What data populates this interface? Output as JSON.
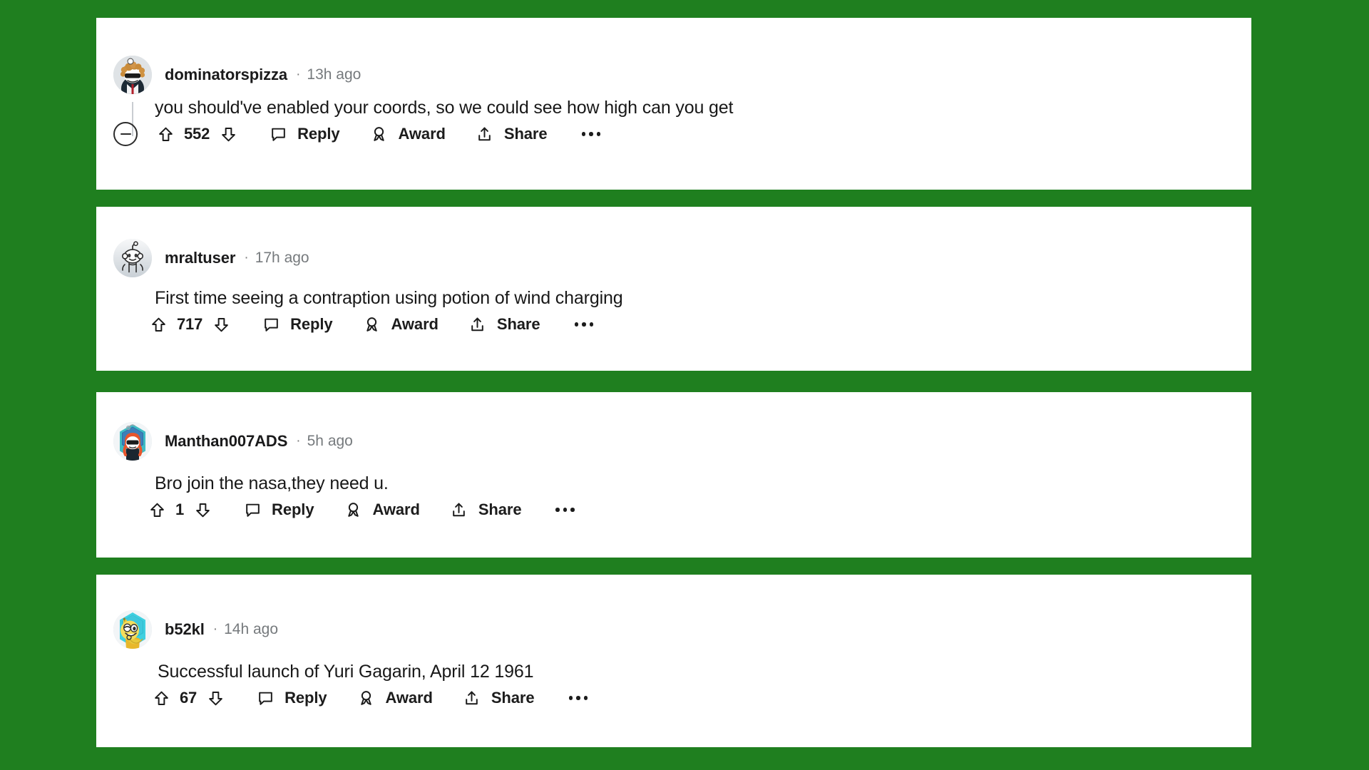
{
  "page": {
    "background_color": "#1f7f1f",
    "card_background": "#ffffff",
    "text_color": "#181818",
    "meta_color": "#767a7d"
  },
  "labels": {
    "reply": "Reply",
    "award": "Award",
    "share": "Share",
    "separator": "·"
  },
  "icons": {
    "collapse": "minus-circle-icon",
    "upvote": "upvote-arrow-icon",
    "downvote": "downvote-arrow-icon",
    "reply": "comment-bubble-icon",
    "award": "award-ribbon-icon",
    "share": "share-upload-icon",
    "overflow": "more-options-icon"
  },
  "comments": [
    {
      "username": "dominatorspizza",
      "timestamp": "13h ago",
      "text": "you should've enabled your coords, so we could see how high can you get",
      "score": "552",
      "has_collapse_button": true,
      "has_thread_line": true,
      "avatar": "avatar-curly-hair-sunglasses-suit"
    },
    {
      "username": "mraltuser",
      "timestamp": "17h ago",
      "text": "First time seeing a contraption using potion of wind charging",
      "score": "717",
      "has_collapse_button": false,
      "has_thread_line": false,
      "avatar": "avatar-default-snoo"
    },
    {
      "username": "Manthan007ADS",
      "timestamp": "5h ago",
      "text": "Bro join the nasa,they need u.",
      "score": "1",
      "has_collapse_button": false,
      "has_thread_line": false,
      "avatar": "avatar-orange-hood-sunglasses"
    },
    {
      "username": "b52kl",
      "timestamp": "14h ago",
      "text": "Successful launch of Yuri Gagarin, April 12 1961",
      "score": "67",
      "has_collapse_button": false,
      "has_thread_line": false,
      "avatar": "avatar-yellow-banana"
    }
  ]
}
